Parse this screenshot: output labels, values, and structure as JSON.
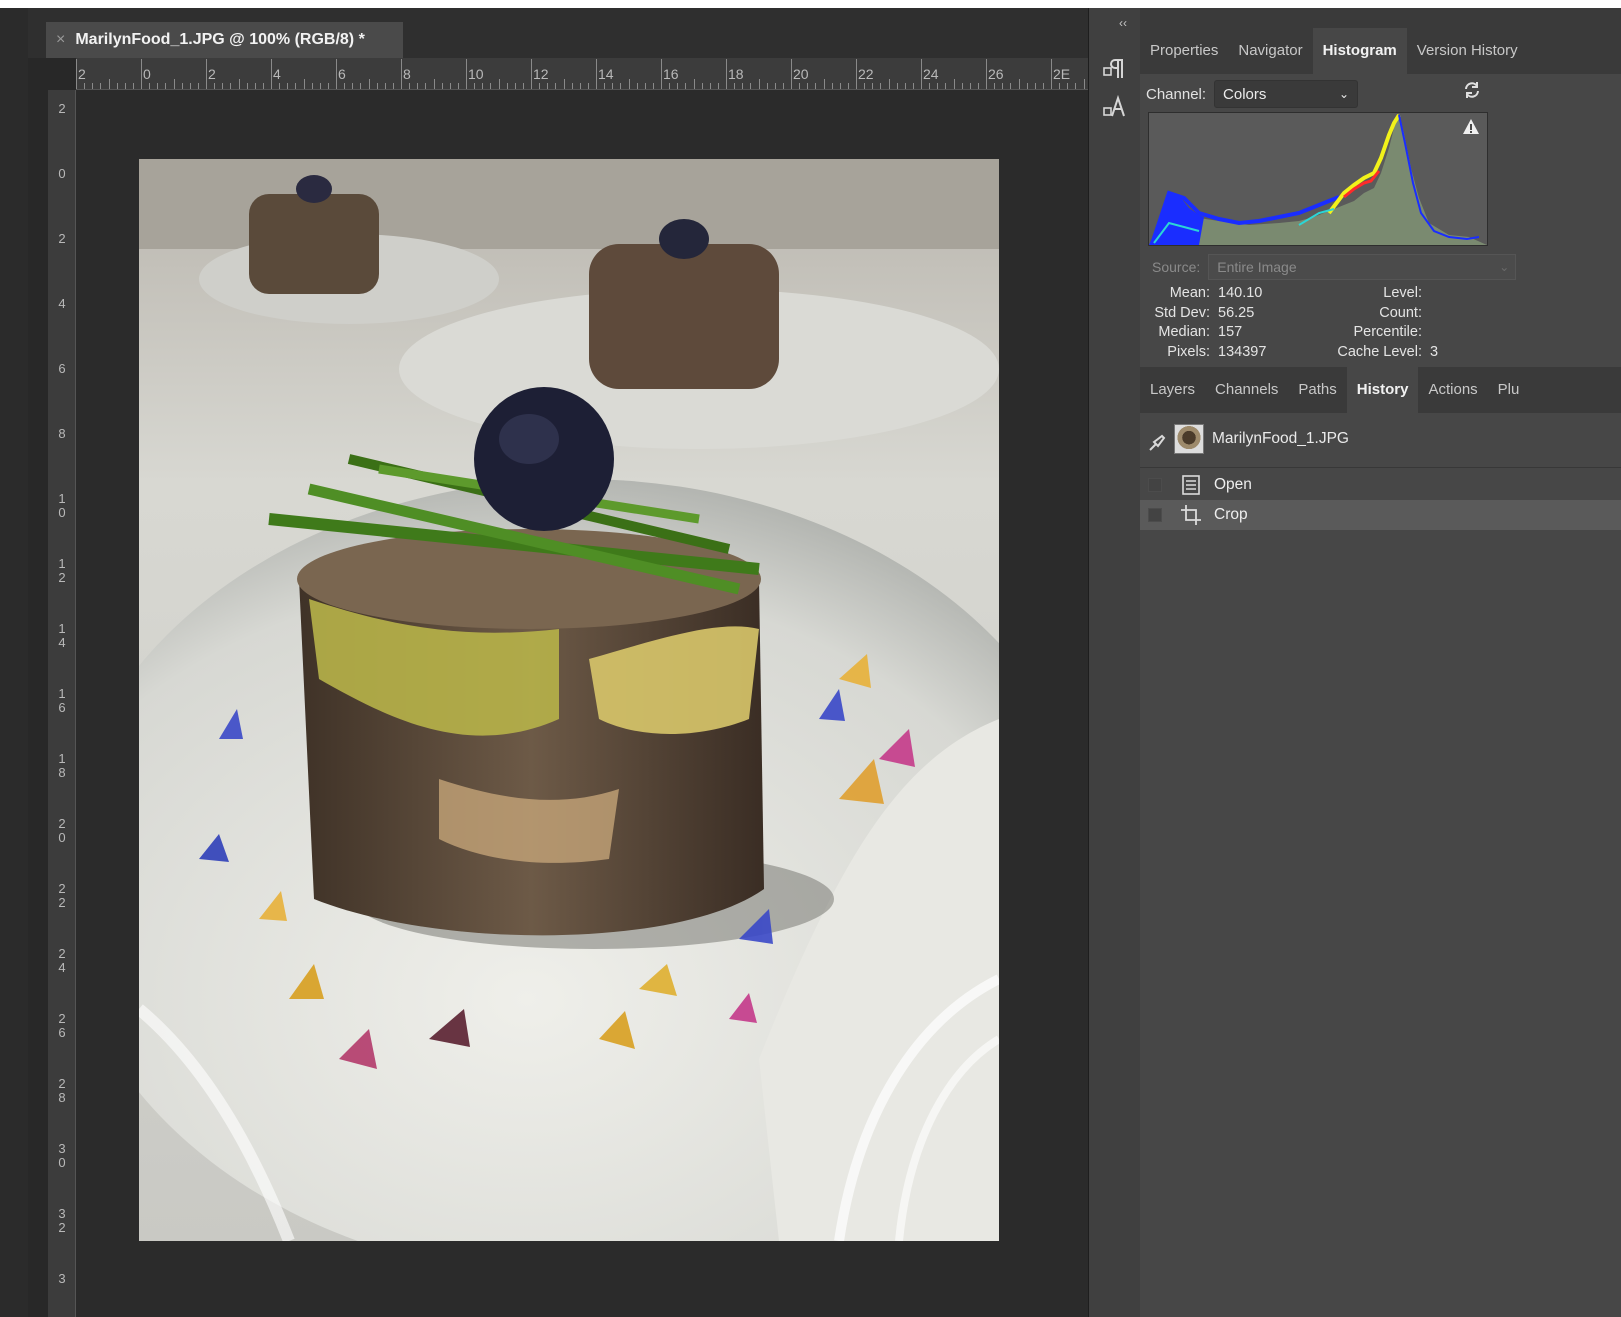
{
  "document": {
    "tab_close": "×",
    "tab_title": "MarilynFood_1.JPG @ 100% (RGB/8) *",
    "ruler_top_labels": [
      "2",
      "0",
      "2",
      "4",
      "6",
      "8",
      "10",
      "12",
      "14",
      "16",
      "18",
      "20",
      "22",
      "24",
      "26",
      "2E"
    ],
    "ruler_left_labels": [
      "2",
      "0",
      "2",
      "4",
      "6",
      "8",
      "1\n0",
      "1\n2",
      "1\n4",
      "1\n6",
      "1\n8",
      "2\n0",
      "2\n2",
      "2\n4",
      "2\n6",
      "2\n8",
      "3\n0",
      "3\n2",
      "3"
    ]
  },
  "icon_column": {
    "collapse": "‹‹",
    "tools": [
      {
        "icon": "paragraph-icon",
        "glyph": "¶"
      },
      {
        "icon": "character-icon",
        "glyph": "A"
      }
    ]
  },
  "top_panel": {
    "tabs": [
      {
        "label": "Properties",
        "active": false
      },
      {
        "label": "Navigator",
        "active": false
      },
      {
        "label": "Histogram",
        "active": true
      },
      {
        "label": "Version History",
        "active": false
      }
    ],
    "channel_label": "Channel:",
    "channel_value": "Colors",
    "source_label": "Source:",
    "source_value": "Entire Image",
    "stats_left": [
      {
        "key": "Mean:",
        "value": "140.10"
      },
      {
        "key": "Std Dev:",
        "value": "56.25"
      },
      {
        "key": "Median:",
        "value": "157"
      },
      {
        "key": "Pixels:",
        "value": "134397"
      }
    ],
    "stats_right": [
      {
        "key": "Level:",
        "value": ""
      },
      {
        "key": "Count:",
        "value": ""
      },
      {
        "key": "Percentile:",
        "value": ""
      },
      {
        "key": "Cache Level:",
        "value": "3"
      }
    ]
  },
  "bottom_panel": {
    "tabs": [
      {
        "label": "Layers",
        "active": false
      },
      {
        "label": "Channels",
        "active": false
      },
      {
        "label": "Paths",
        "active": false
      },
      {
        "label": "History",
        "active": true
      },
      {
        "label": "Actions",
        "active": false
      },
      {
        "label": "Plu",
        "active": false
      }
    ],
    "snapshot_name": "MarilynFood_1.JPG",
    "history_items": [
      {
        "label": "Open",
        "icon": "document-icon",
        "selected": false
      },
      {
        "label": "Crop",
        "icon": "crop-icon",
        "selected": true
      }
    ]
  },
  "colors": {
    "panel_bg": "#474747",
    "tab_bar_bg": "#3a3a3a",
    "canvas_bg": "#2b2b2b",
    "histogram_blue": "#1a2dff",
    "histogram_red": "#ff2a2a",
    "histogram_yellow": "#f2f21a",
    "histogram_gray": "#7a8a70"
  }
}
